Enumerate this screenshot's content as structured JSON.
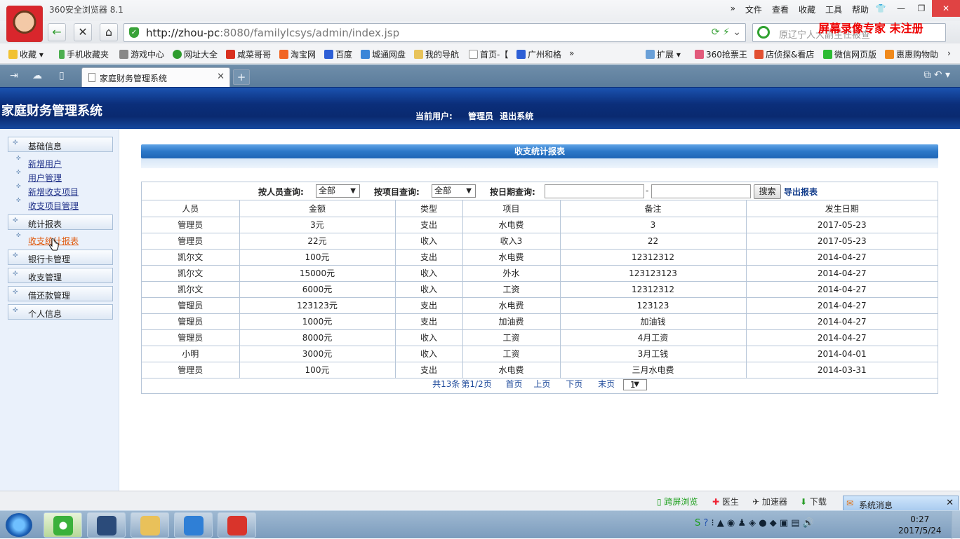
{
  "browser": {
    "app_title": "360安全浏览器 8.1",
    "menu": [
      "文件",
      "查看",
      "收藏",
      "工具",
      "帮助"
    ],
    "url_host": "http://zhou-pc",
    "url_rest": ":8080/familylcsys/admin/index.jsp",
    "search_placeholder": "原辽宁人大副主任被查",
    "watermark": "屏幕录像专家  未注册",
    "bookmarks": [
      "收藏",
      "手机收藏夹",
      "游戏中心",
      "网址大全",
      "咸菜哥哥",
      "淘宝网",
      "百度",
      "城通网盘",
      "我的导航",
      "首页-【",
      "广州和格"
    ],
    "bookmarks_right": [
      "扩展",
      "360抢票王",
      "店侦探&看店",
      "微信网页版",
      "惠惠购物助"
    ],
    "tab_title": "家庭财务管理系统"
  },
  "header": {
    "system_name": "家庭财务管理系统",
    "current_user_label": "当前用户:",
    "user_name": "管理员",
    "logout": "退出系统"
  },
  "sidebar": {
    "groups": [
      {
        "label": "基础信息",
        "items": [
          "新增用户",
          "用户管理",
          "新增收支项目",
          "收支项目管理"
        ]
      },
      {
        "label": "统计报表",
        "items": [
          "收支统计报表"
        ]
      },
      {
        "label": "银行卡管理",
        "items": []
      },
      {
        "label": "收支管理",
        "items": []
      },
      {
        "label": "借还款管理",
        "items": []
      },
      {
        "label": "个人信息",
        "items": []
      }
    ]
  },
  "report": {
    "title": "收支统计报表",
    "filter": {
      "by_person_label": "按人员查询:",
      "by_person_value": "全部",
      "by_item_label": "按项目查询:",
      "by_item_value": "全部",
      "by_date_label": "按日期查询:",
      "date_sep": "-",
      "search_button": "搜索",
      "export_link": "导出报表"
    },
    "columns": [
      "人员",
      "金额",
      "类型",
      "项目",
      "备注",
      "发生日期"
    ],
    "rows": [
      [
        "管理员",
        "3元",
        "支出",
        "水电费",
        "3",
        "2017-05-23"
      ],
      [
        "管理员",
        "22元",
        "收入",
        "收入3",
        "22",
        "2017-05-23"
      ],
      [
        "凯尔文",
        "100元",
        "支出",
        "水电费",
        "12312312",
        "2014-04-27"
      ],
      [
        "凯尔文",
        "15000元",
        "收入",
        "外水",
        "123123123",
        "2014-04-27"
      ],
      [
        "凯尔文",
        "6000元",
        "收入",
        "工资",
        "12312312",
        "2014-04-27"
      ],
      [
        "管理员",
        "123123元",
        "支出",
        "水电费",
        "123123",
        "2014-04-27"
      ],
      [
        "管理员",
        "1000元",
        "支出",
        "加油费",
        "加油钱",
        "2014-04-27"
      ],
      [
        "管理员",
        "8000元",
        "收入",
        "工资",
        "4月工资",
        "2014-04-27"
      ],
      [
        "小明",
        "3000元",
        "收入",
        "工资",
        "3月工钱",
        "2014-04-01"
      ],
      [
        "管理员",
        "100元",
        "支出",
        "水电费",
        "三月水电费",
        "2014-03-31"
      ]
    ],
    "pager": {
      "total": "共13条",
      "page_info": "第1/2页",
      "first": "首页",
      "prev": "上页",
      "next": "下页",
      "last": "末页",
      "page_select": "1"
    }
  },
  "statusbar": {
    "items": [
      "跨屏浏览",
      "医生",
      "加速器",
      "下载"
    ],
    "popup_title": "系统消息"
  },
  "taskbar": {
    "time": "0:27",
    "date": "2017/5/24"
  }
}
